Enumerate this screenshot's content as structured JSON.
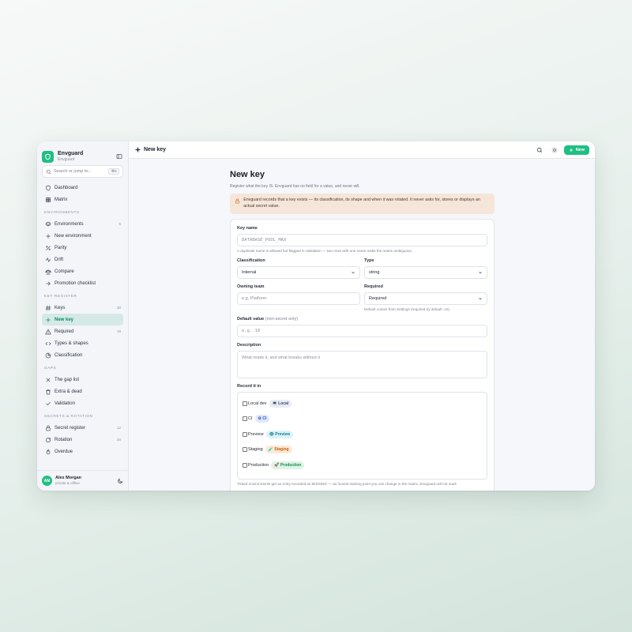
{
  "brand": {
    "name": "Envguard",
    "sub": "Envguard"
  },
  "search": {
    "placeholder": "Search or jump to...",
    "shortcut": "⌘K"
  },
  "sidebar": {
    "top": [
      {
        "label": "Dashboard",
        "icon": "shield-icon"
      },
      {
        "label": "Matrix",
        "icon": "grid-icon"
      }
    ],
    "sections": [
      {
        "title": "ENVIRONMENTS",
        "items": [
          {
            "label": "Environments",
            "count": "5",
            "icon": "layers-icon"
          },
          {
            "label": "New environment",
            "count": "",
            "icon": "plus-icon"
          },
          {
            "label": "Parity",
            "count": "",
            "icon": "percent-icon"
          },
          {
            "label": "Drift",
            "count": "",
            "icon": "activity-icon"
          },
          {
            "label": "Compare",
            "count": "",
            "icon": "scale-icon"
          },
          {
            "label": "Promotion checklist",
            "count": "",
            "icon": "arrow-right-icon"
          }
        ]
      },
      {
        "title": "KEY REGISTER",
        "items": [
          {
            "label": "Keys",
            "count": "30",
            "icon": "hash-icon"
          },
          {
            "label": "New key",
            "count": "",
            "icon": "plus-icon",
            "active": true
          },
          {
            "label": "Required",
            "count": "19",
            "icon": "warning-icon"
          },
          {
            "label": "Types & shapes",
            "count": "",
            "icon": "code-icon"
          },
          {
            "label": "Classification",
            "count": "",
            "icon": "pie-icon"
          }
        ]
      },
      {
        "title": "GAPS",
        "items": [
          {
            "label": "The gap list",
            "count": "",
            "icon": "x-icon"
          },
          {
            "label": "Extra & dead",
            "count": "",
            "icon": "trash-icon"
          },
          {
            "label": "Validation",
            "count": "",
            "icon": "check-icon"
          }
        ]
      },
      {
        "title": "SECRETS & ROTATION",
        "items": [
          {
            "label": "Secret register",
            "count": "12",
            "icon": "lock-icon"
          },
          {
            "label": "Rotation",
            "count": "20",
            "icon": "refresh-icon"
          },
          {
            "label": "Overdue",
            "count": "",
            "icon": "flame-icon"
          }
        ]
      }
    ]
  },
  "user": {
    "initials": "AM",
    "name": "Alex Morgan",
    "sub": "private & offline"
  },
  "topbar": {
    "title": "New key",
    "new_label": "New"
  },
  "page": {
    "title": "New key",
    "subtitle": "Register what the key IS. Envguard has no field for a value, and never will.",
    "notice": "Envguard records that a key exists — its classification, its shape and when it was rotated. It never asks for, stores or displays an actual secret value."
  },
  "form": {
    "key_name": {
      "label": "Key name",
      "placeholder": "DATABASE_POOL_MAX",
      "hint": "A duplicate name is allowed but flagged in Validation — two rows with one name make the matrix ambiguous."
    },
    "classification": {
      "label": "Classification",
      "value": "Internal"
    },
    "type": {
      "label": "Type",
      "value": "string"
    },
    "owning_team": {
      "label": "Owning team",
      "placeholder": "e.g. Platform"
    },
    "required": {
      "label": "Required",
      "value": "Required",
      "hint": "Default comes from Settings (required by default: on)."
    },
    "default_value": {
      "label": "Default value",
      "label_note": "(non-secret only)",
      "placeholder": "e.g. 10"
    },
    "description": {
      "label": "Description",
      "placeholder": "What reads it, and what breaks without it"
    },
    "record_in": {
      "label": "Record it in",
      "envs": [
        {
          "name": "Local dev",
          "pill": "💻 Local",
          "bg": "#e8ecf5",
          "fg": "#3b4a6b"
        },
        {
          "name": "CI",
          "pill": "⚙ CI",
          "bg": "#dfe9fb",
          "fg": "#2f5fc4"
        },
        {
          "name": "Preview",
          "pill": "👁 Preview",
          "bg": "#dcf3f7",
          "fg": "#137f93"
        },
        {
          "name": "Staging",
          "pill": "🧪 Staging",
          "bg": "#fde9d6",
          "fg": "#c26012"
        },
        {
          "name": "Production",
          "pill": "🚀 Production",
          "bg": "#ddf4e6",
          "fg": "#198a4a"
        }
      ],
      "hint": "Ticked environments get an entry recorded as MISSING — an honest starting point you can change in the matrix. Envguard will not mark"
    }
  }
}
